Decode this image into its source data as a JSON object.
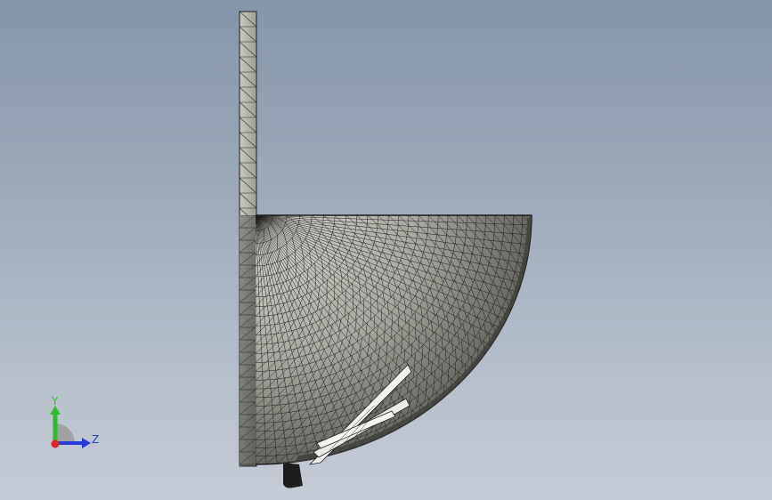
{
  "viewport": {
    "background_top": "#8595a8",
    "background_bottom": "#c6ccd6"
  },
  "model": {
    "render_mode": "shaded-with-edges",
    "mesh_edge_color": "#1f1f1f",
    "fill_light": "#e4e4dc",
    "fill_dark": "#4a4a46"
  },
  "triad": {
    "y_label": "Y",
    "z_label": "Z",
    "y_color": "#2bbf2b",
    "z_color": "#2a3ad6",
    "x_color": "#e02424",
    "plane_color": "#9a9a9a"
  }
}
